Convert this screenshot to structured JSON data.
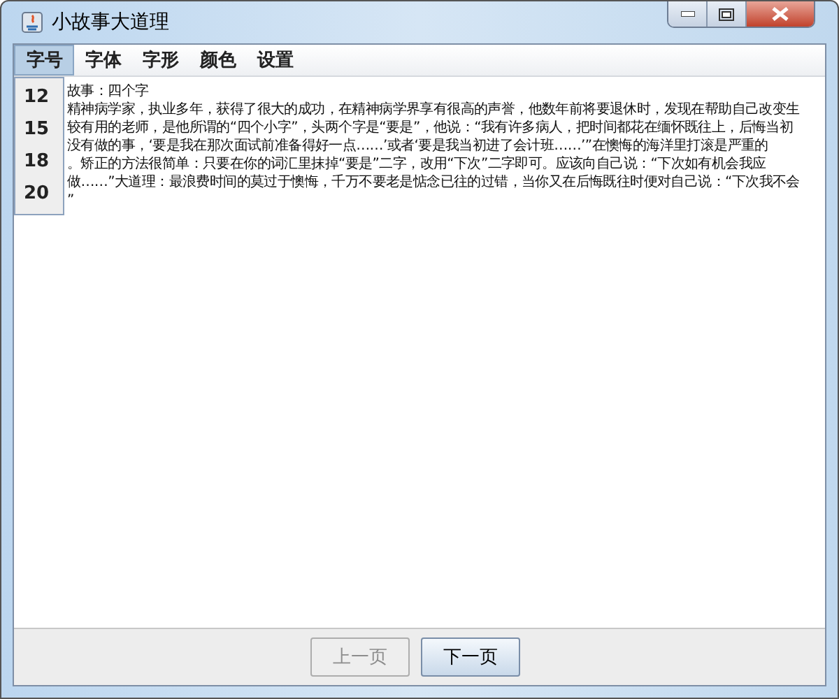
{
  "window": {
    "title": "小故事大道理"
  },
  "menu": [
    {
      "label": "字号",
      "selected": true
    },
    {
      "label": "字体",
      "selected": false
    },
    {
      "label": "字形",
      "selected": false
    },
    {
      "label": "颜色",
      "selected": false
    },
    {
      "label": "设置",
      "selected": false
    }
  ],
  "dropdown": {
    "items": [
      {
        "label": "12"
      },
      {
        "label": "15"
      },
      {
        "label": "18"
      },
      {
        "label": "20"
      }
    ]
  },
  "story": {
    "lines": [
      "故事：四个字",
      "精神病学家，执业多年，获得了很大的成功，在精神病学界享有很高的声誉，他数年前将要退休时，发现在帮助自己改变生",
      "较有用的老师，是他所谓的“四个小字”，头两个字是“要是”，他说：“我有许多病人，把时间都花在缅怀既往上，后悔当初",
      "没有做的事，‘要是我在那次面试前准备得好一点……’或者‘要是我当初进了会计班……’”在懊悔的海洋里打滚是严重的",
      "。矫正的方法很简单：只要在你的词汇里抹掉“要是”二字，改用“下次”二字即可。应该向自己说：“下次如有机会我应",
      "做……”大道理：最浪费时间的莫过于懊悔，千万不要老是惦念已往的过错，当你又在后悔既往时便对自己说：“下次我不会",
      "”"
    ]
  },
  "buttons": [
    {
      "label": "上一页",
      "disabled": true
    },
    {
      "label": "下一页",
      "disabled": false
    }
  ]
}
